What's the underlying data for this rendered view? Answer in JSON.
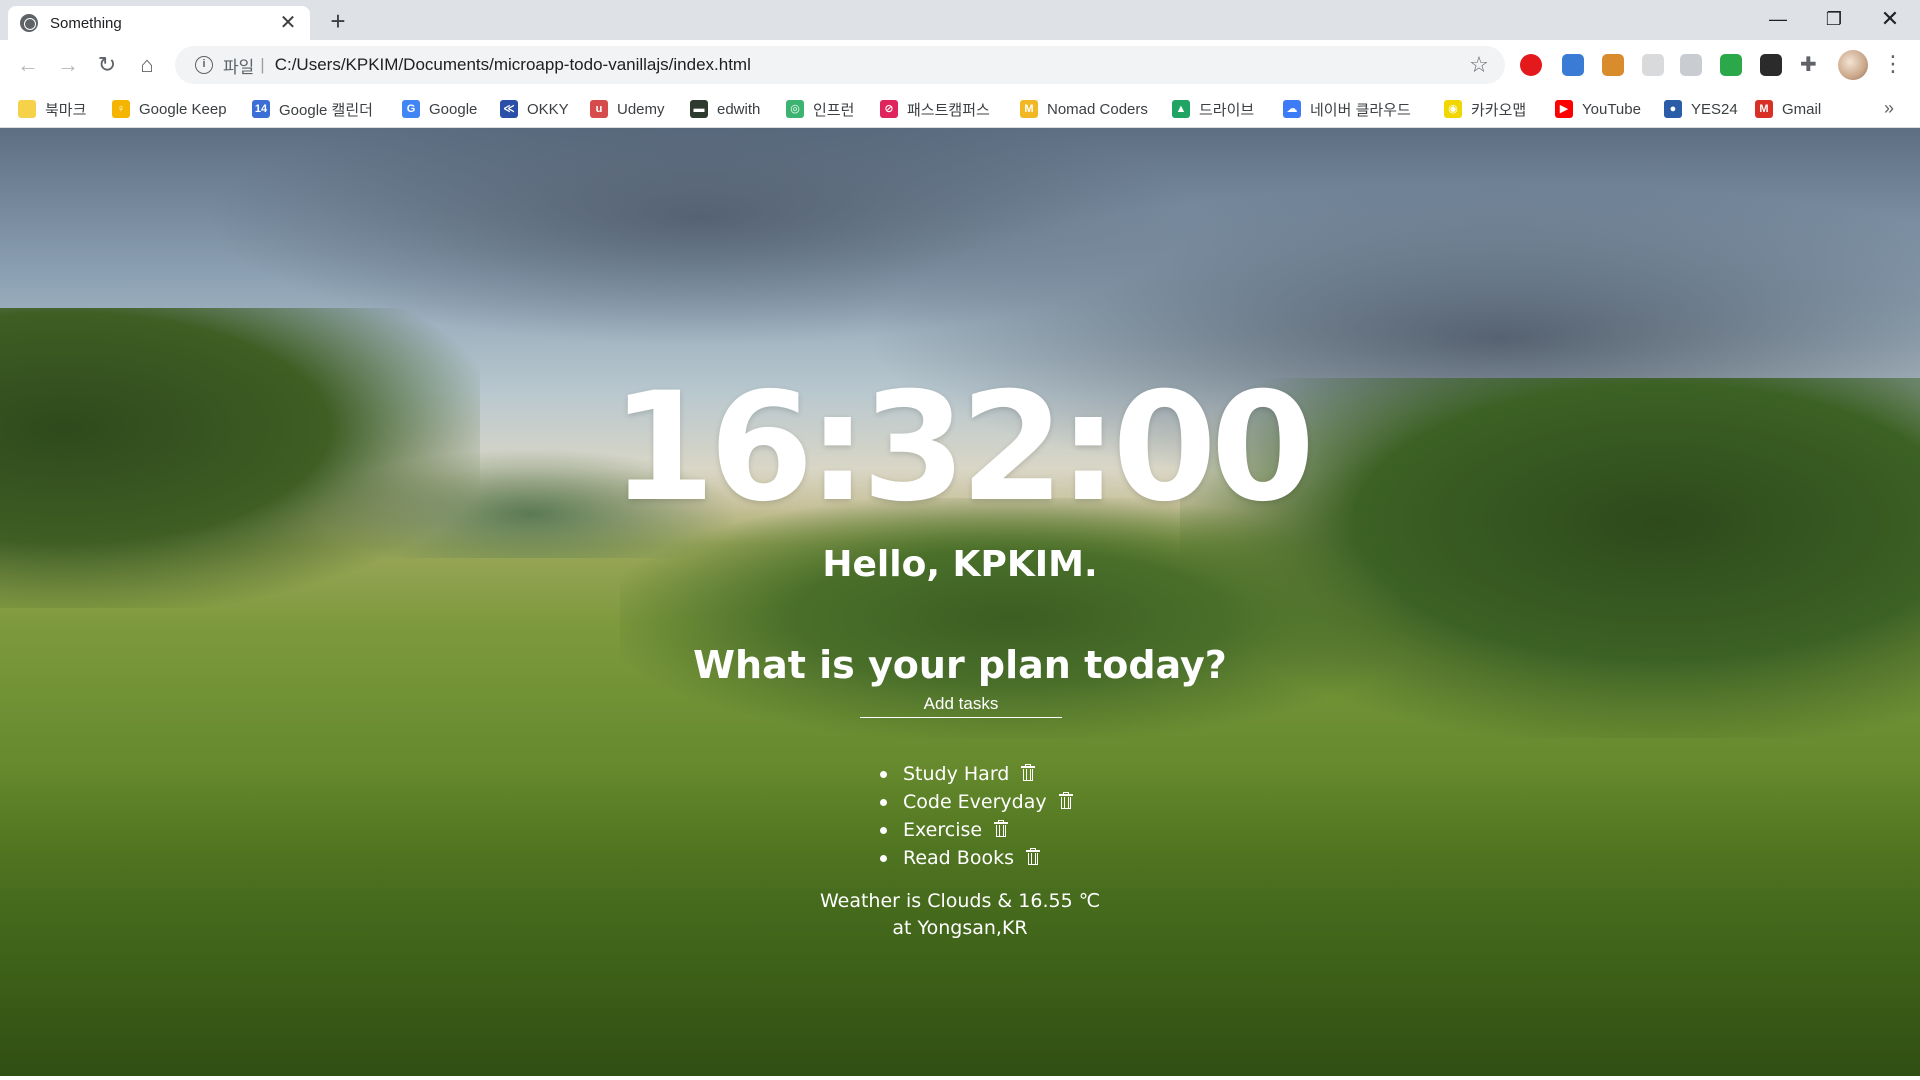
{
  "browser": {
    "tab_title": "Something",
    "tab_close": "✕",
    "new_tab": "+",
    "window_controls": {
      "minimize": "—",
      "maximize": "❐",
      "close": "✕"
    }
  },
  "toolbar": {
    "back": "←",
    "forward": "→",
    "reload": "↻",
    "home": "⌂",
    "info_icon": "i",
    "scheme_label": "파일",
    "separator": "|",
    "url": "C:/Users/KPKIM/Documents/microapp-todo-vanillajs/index.html",
    "star": "☆",
    "puzzle": "✚",
    "menu": "⋮"
  },
  "extensions": [
    {
      "name": "opera-icon",
      "color": "#e3191b"
    },
    {
      "name": "pen-tool-icon",
      "color": "#3a7bd5"
    },
    {
      "name": "hammer-icon",
      "color": "#d98c2b"
    },
    {
      "name": "blank-extension-icon",
      "color": "#d9dadc"
    },
    {
      "name": "clock-extension-icon",
      "color": "#c9cdd2"
    },
    {
      "name": "green-extension-icon",
      "color": "#2aa84a"
    },
    {
      "name": "mask-extension-icon",
      "color": "#2b2b2b"
    }
  ],
  "bookmarks": {
    "more": "»",
    "items": [
      {
        "label": "북마크",
        "icon": "folder-icon",
        "color": "#f6d24b",
        "glyph": ""
      },
      {
        "label": "Google Keep",
        "icon": "keep-icon",
        "color": "#f5b400",
        "glyph": "♀"
      },
      {
        "label": "Google 캘린더",
        "icon": "calendar-icon",
        "color": "#3b6fd6",
        "glyph": "14"
      },
      {
        "label": "Google",
        "icon": "google-icon",
        "color": "#4285f4",
        "glyph": "G"
      },
      {
        "label": "OKKY",
        "icon": "okky-icon",
        "color": "#2b4fa8",
        "glyph": "≪"
      },
      {
        "label": "Udemy",
        "icon": "udemy-icon",
        "color": "#d64b4b",
        "glyph": "u"
      },
      {
        "label": "edwith",
        "icon": "edwith-icon",
        "color": "#2e3a2e",
        "glyph": "▬"
      },
      {
        "label": "인프런",
        "icon": "inflearn-icon",
        "color": "#3cb371",
        "glyph": "◎"
      },
      {
        "label": "패스트캠퍼스",
        "icon": "fastcampus-icon",
        "color": "#e0245e",
        "glyph": "⊘"
      },
      {
        "label": "Nomad Coders",
        "icon": "nomad-icon",
        "color": "#f2b824",
        "glyph": "M"
      },
      {
        "label": "드라이브",
        "icon": "drive-icon",
        "color": "#1fa463",
        "glyph": "▲"
      },
      {
        "label": "네이버 클라우드",
        "icon": "naver-cloud-icon",
        "color": "#3d7bf7",
        "glyph": "☁"
      },
      {
        "label": "카카오맵",
        "icon": "kakaomap-icon",
        "color": "#f2d600",
        "glyph": "◉"
      },
      {
        "label": "YouTube",
        "icon": "youtube-icon",
        "color": "#ff0000",
        "glyph": "▶"
      },
      {
        "label": "YES24",
        "icon": "yes24-icon",
        "color": "#2b5ca8",
        "glyph": "●"
      },
      {
        "label": "Gmail",
        "icon": "gmail-icon",
        "color": "#d93025",
        "glyph": "M"
      }
    ]
  },
  "app": {
    "clock": "16:32:00",
    "greeting": "Hello, KPKIM.",
    "question": "What is your plan today?",
    "task_placeholder": "Add tasks",
    "todos": [
      {
        "text": "Study Hard"
      },
      {
        "text": "Code Everyday"
      },
      {
        "text": "Exercise"
      },
      {
        "text": "Read Books"
      }
    ],
    "weather_line1": "Weather is Clouds & 16.55 ℃",
    "weather_line2": "at Yongsan,KR"
  }
}
